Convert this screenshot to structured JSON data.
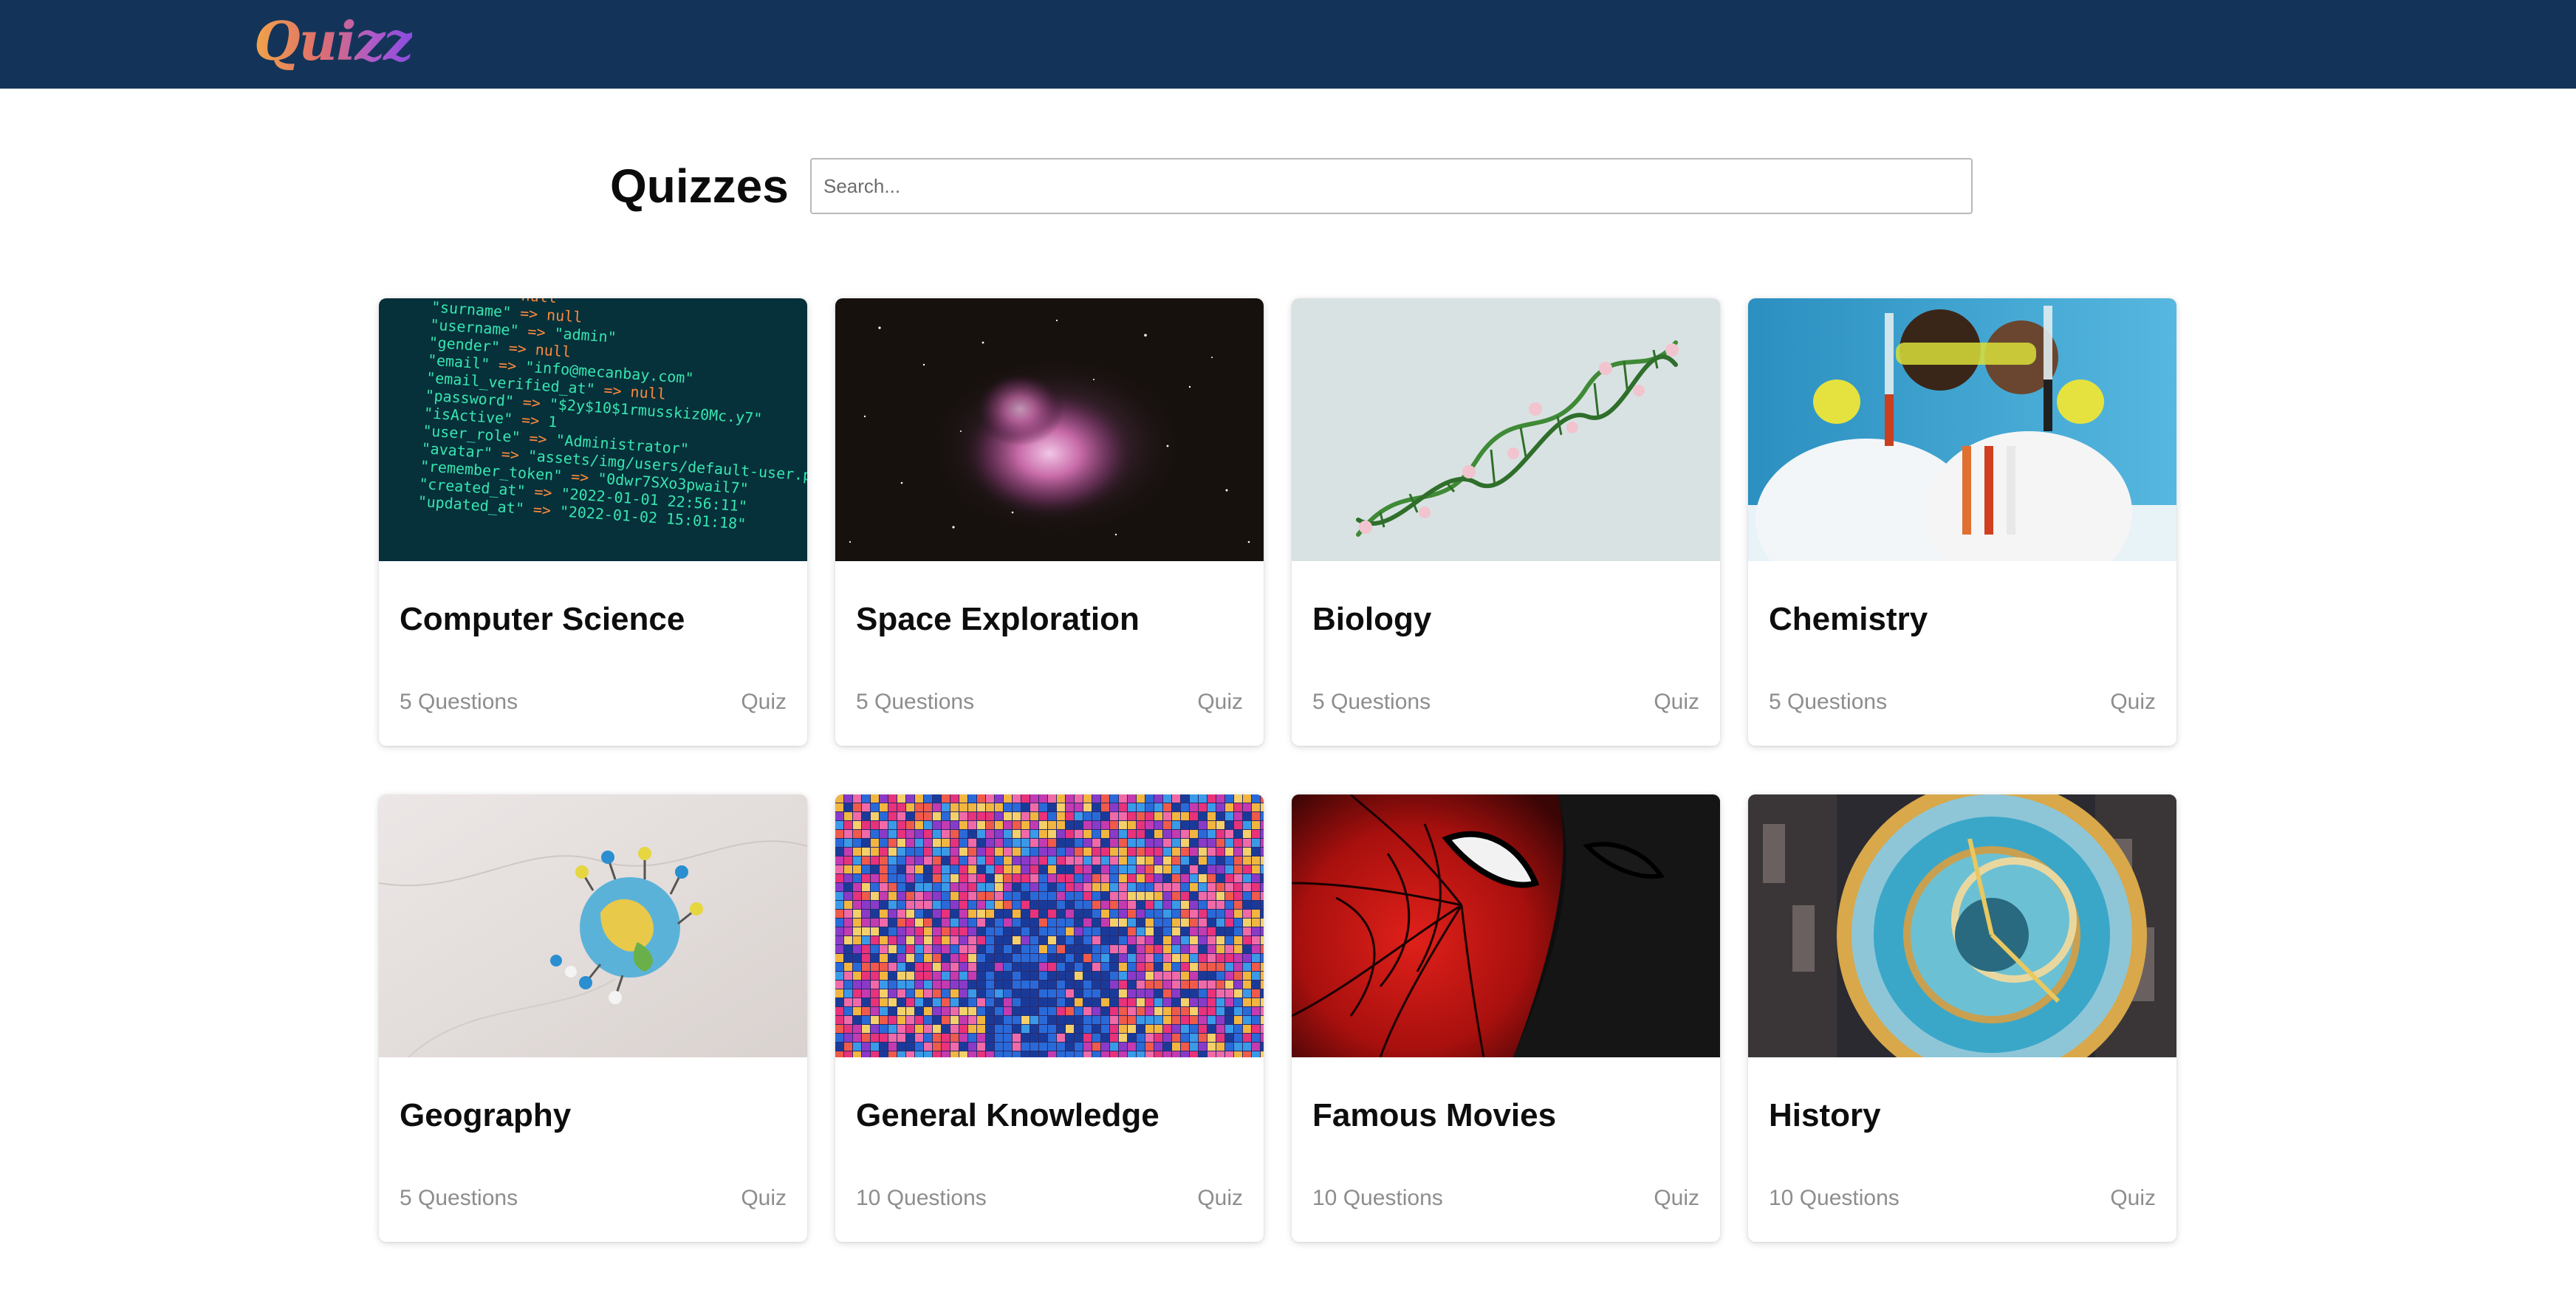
{
  "header": {
    "logo_text": "Quizz"
  },
  "main": {
    "title": "Quizzes",
    "search": {
      "placeholder": "Search...",
      "value": ""
    }
  },
  "quizzes": [
    {
      "title": "Computer Science",
      "count": "5 Questions",
      "type": "Quiz"
    },
    {
      "title": "Space Exploration",
      "count": "5 Questions",
      "type": "Quiz"
    },
    {
      "title": "Biology",
      "count": "5 Questions",
      "type": "Quiz"
    },
    {
      "title": "Chemistry",
      "count": "5 Questions",
      "type": "Quiz"
    },
    {
      "title": "Geography",
      "count": "5 Questions",
      "type": "Quiz"
    },
    {
      "title": "General Knowledge",
      "count": "10 Questions",
      "type": "Quiz"
    },
    {
      "title": "Famous Movies",
      "count": "10 Questions",
      "type": "Quiz"
    },
    {
      "title": "History",
      "count": "10 Questions",
      "type": "Quiz"
    }
  ],
  "colors": {
    "header_bg": "#133458",
    "logo_gradient": [
      "#f0a44a",
      "#e0706a",
      "#b05ac8",
      "#8a4ce0"
    ],
    "meta_text": "#8d8d8d"
  },
  "images": [
    "code-terminal-image",
    "orion-nebula-image",
    "dna-flowers-image",
    "chemists-lab-image",
    "globe-pins-image",
    "colorful-pixel-art-image",
    "spiderman-mask-image",
    "astronomical-clock-image"
  ]
}
